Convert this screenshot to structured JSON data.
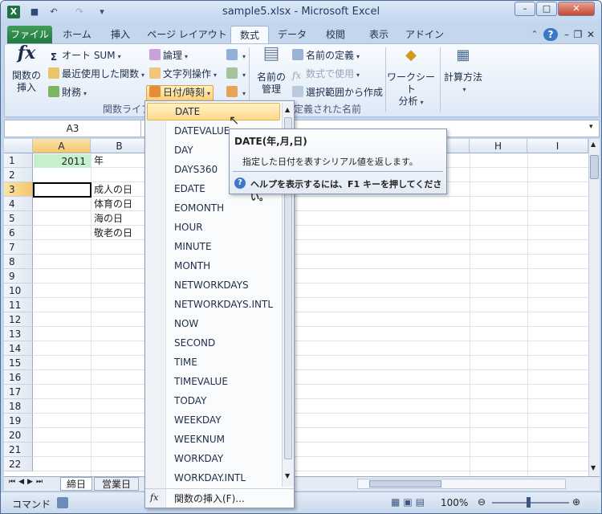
{
  "window": {
    "title": "sample5.xlsx - Microsoft Excel"
  },
  "qat": {
    "save_icon": "save-icon",
    "undo_icon": "undo-icon",
    "redo_icon": "redo-icon"
  },
  "tabs": [
    {
      "label": "ファイル"
    },
    {
      "label": "ホーム"
    },
    {
      "label": "挿入"
    },
    {
      "label": "ページ レイアウト"
    },
    {
      "label": "数式"
    },
    {
      "label": "データ"
    },
    {
      "label": "校閲"
    },
    {
      "label": "表示"
    },
    {
      "label": "アドイン"
    }
  ],
  "active_tab": "数式",
  "ribbon": {
    "insert_function": {
      "label1": "関数の",
      "label2": "挿入",
      "glyph": "fx"
    },
    "autosum": "オート SUM",
    "recent": "最近使用した関数",
    "financial": "財務",
    "logical": "論理",
    "text": "文字列操作",
    "datetime": "日付/時刻",
    "group_function_library": "関数ライブラリ",
    "name_manager": {
      "label1": "名前の",
      "label2": "管理"
    },
    "define_name": "名前の定義",
    "use_in_formula": "数式で使用",
    "create_from_selection": "選択範囲から作成",
    "group_defined_names": "定義された名前",
    "watch": {
      "label1": "ワークシート",
      "label2": "分析"
    },
    "calc": {
      "label1": "計算方法"
    }
  },
  "namebox": "A3",
  "columns": [
    "A",
    "B",
    "H",
    "I"
  ],
  "rows": [
    "1",
    "2",
    "3",
    "4",
    "5",
    "6",
    "7",
    "8",
    "9",
    "10",
    "11",
    "12",
    "13",
    "14",
    "15",
    "16",
    "17",
    "18",
    "19",
    "20",
    "21",
    "22"
  ],
  "cells": {
    "a1": "2011",
    "b1": "年",
    "b3": "成人の日",
    "b4": "体育の日",
    "b5": "海の日",
    "b6": "敬老の日"
  },
  "menu": {
    "items": [
      "DATE",
      "DATEVALUE",
      "DAY",
      "DAYS360",
      "EDATE",
      "EOMONTH",
      "HOUR",
      "MINUTE",
      "MONTH",
      "NETWORKDAYS",
      "NETWORKDAYS.INTL",
      "NOW",
      "SECOND",
      "TIME",
      "TIMEVALUE",
      "TODAY",
      "WEEKDAY",
      "WEEKNUM",
      "WORKDAY",
      "WORKDAY.INTL"
    ],
    "selected": "DATE",
    "insert_function": "関数の挿入(F)...",
    "insert_glyph": "fx"
  },
  "tooltip": {
    "title": "DATE(年,月,日)",
    "desc": "指定した日付を表すシリアル値を返します。",
    "help": "ヘルプを表示するには、F1 キーを押してください。",
    "help_glyph": "?"
  },
  "sheets": [
    "締日",
    "営業日"
  ],
  "status": {
    "mode": "コマンド",
    "zoom": "100%"
  },
  "colors": {
    "excel_green": "#217a3e",
    "selection": "#ffd98c",
    "a1_fill": "#c6efce"
  }
}
